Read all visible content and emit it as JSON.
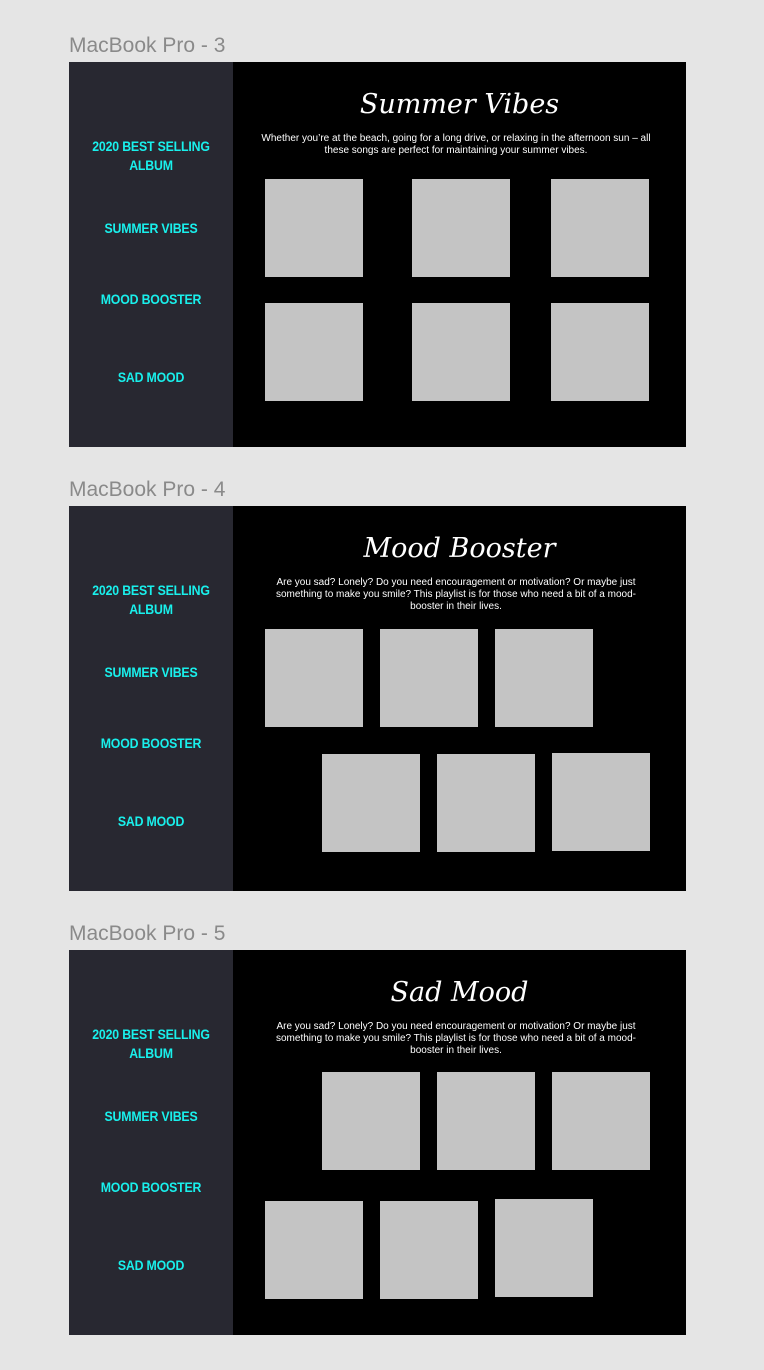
{
  "frames": [
    {
      "label": "MacBook Pro - 3",
      "nav": [
        "2020 BEST SELLING ALBUM",
        "SUMMER VIBES",
        "MOOD BOOSTER",
        "SAD MOOD"
      ],
      "title": "Summer Vibes",
      "description": "Whether you’re at the beach, going for a long drive, or relaxing in the afternoon sun – all these songs are perfect for maintaining your summer vibes."
    },
    {
      "label": "MacBook Pro - 4",
      "nav": [
        "2020 BEST SELLING ALBUM",
        "SUMMER VIBES",
        "MOOD BOOSTER",
        "SAD MOOD"
      ],
      "title": "Mood Booster",
      "description": "Are you sad? Lonely? Do you need encouragement or motivation? Or maybe just something to make you smile? This playlist is for those who need a bit of a mood-booster in their lives."
    },
    {
      "label": "MacBook Pro - 5",
      "nav": [
        "2020 BEST SELLING ALBUM",
        "SUMMER VIBES",
        "MOOD BOOSTER",
        "SAD MOOD"
      ],
      "title": "Sad Mood",
      "description": "Are you sad? Lonely? Do you need encouragement or motivation? Or maybe just something to make you smile? This playlist is for those who need a bit of a mood-booster in their lives."
    }
  ],
  "colors": {
    "canvas": "#e5e5e5",
    "frame_label": "#8a8a8a",
    "sidebar": "#282831",
    "main": "#000000",
    "nav_text": "#19f0ec",
    "title_text": "#ffffff",
    "tile": "#c4c4c4"
  }
}
